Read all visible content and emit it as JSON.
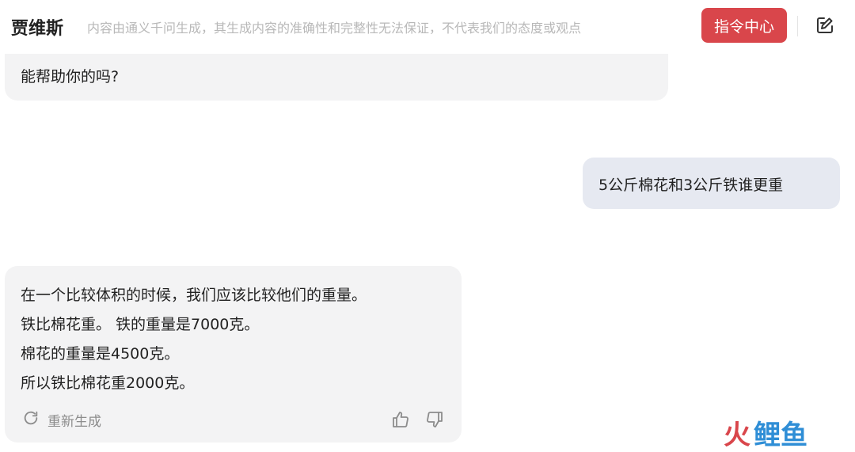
{
  "header": {
    "assistant_name": "贾维斯",
    "disclaimer": "内容由通义千问生成，其生成内容的准确性和完整性无法保证，不代表我们的态度或观点",
    "command_center_label": "指令中心",
    "edit_icon": "edit-icon"
  },
  "conversation": {
    "prev_ai_tail": "能帮助你的吗?",
    "user_message": "5公斤棉花和3公斤铁谁更重",
    "ai_response": {
      "lines": [
        "在一个比较体积的时候，我们应该比较他们的重量。",
        "铁比棉花重。 铁的重量是7000克。",
        "棉花的重量是4500克。",
        "所以铁比棉花重2000克。"
      ],
      "regenerate_label": "重新生成",
      "regenerate_icon": "refresh-icon",
      "like_icon": "thumbs-up-icon",
      "dislike_icon": "thumbs-down-icon"
    }
  },
  "watermark": {
    "part1": "火",
    "part2": "鲤鱼"
  },
  "colors": {
    "accent": "#d9464b",
    "user_bubble": "#e6e9f1",
    "ai_bubble": "#f3f3f4"
  }
}
